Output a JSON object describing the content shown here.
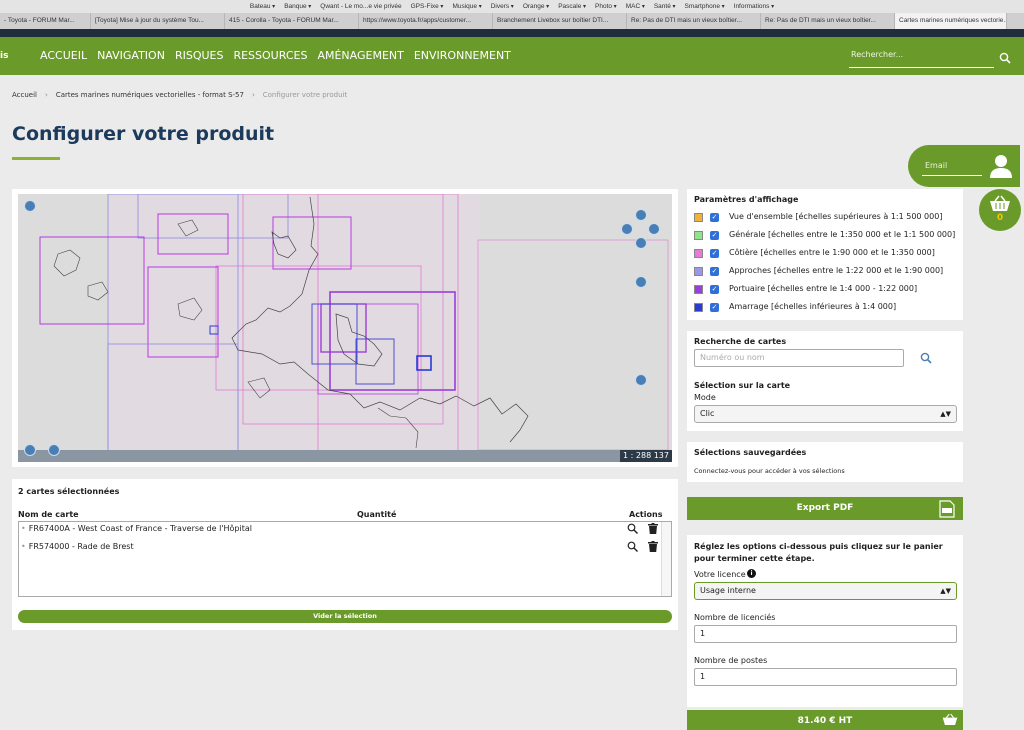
{
  "browser": {
    "bookmarks": [
      "Bateau",
      "Banque",
      "Qwant - Le mo...e vie privée",
      "GPS-Fixe",
      "Musique",
      "Divers",
      "Orange",
      "Pascale",
      "Photo",
      "MAC",
      "Santé",
      "Smartphone",
      "Informations"
    ],
    "tabs": [
      "- Toyota - FORUM Mar...",
      "[Toyota] Mise à jour du système Tou...",
      "415 - Corolla - Toyota - FORUM Mar...",
      "https://www.toyota.fr/apps/customer...",
      "Branchement Livebox sur boîtier DTI...",
      "Re: Pas de DTI mais un vieux boîtier...",
      "Re: Pas de DTI mais un vieux boîtier...",
      "Cartes marines numériques vectorie..."
    ]
  },
  "nav": {
    "brand": "is",
    "items": [
      "ACCUEIL",
      "NAVIGATION",
      "RISQUES",
      "RESSOURCES",
      "AMÉNAGEMENT",
      "ENVIRONNEMENT"
    ],
    "search_placeholder": "Rechercher..."
  },
  "breadcrumb": [
    "Accueil",
    "Cartes marines numériques vectorielles - format S-57",
    "Configurer votre produit"
  ],
  "page_title": "Configurer votre produit",
  "account": {
    "email_placeholder": "Email",
    "cart_count": "0"
  },
  "map": {
    "scale": "1 : 288 137"
  },
  "selection": {
    "count_label": "2 cartes sélectionnées",
    "col_name": "Nom de carte",
    "col_qty": "Quantité",
    "col_actions": "Actions",
    "rows": [
      {
        "name": "FR67400A - West Coast of France - Traverse de l'Hôpital"
      },
      {
        "name": "FR574000 - Rade de Brest"
      }
    ],
    "clear_label": "Vider la sélection"
  },
  "display": {
    "title": "Paramètres d'affichage",
    "layers": [
      {
        "color": "#f2b13a",
        "label": "Vue d'ensemble [échelles supérieures à 1:1 500 000]"
      },
      {
        "color": "#8fe68a",
        "label": "Générale [échelles entre le 1:350 000 et le 1:1 500 000]"
      },
      {
        "color": "#e77ad6",
        "label": "Côtière [échelles entre le 1:90 000 et le 1:350 000]"
      },
      {
        "color": "#9b95ee",
        "label": "Approches [échelles entre le 1:22 000 et le 1:90 000]"
      },
      {
        "color": "#9a3fd8",
        "label": "Portuaire [échelles entre le 1:4 000 - 1:22 000]"
      },
      {
        "color": "#2b3bd6",
        "label": "Amarrage [échelles inférieures à 1:4 000]"
      }
    ]
  },
  "search": {
    "title": "Recherche de cartes",
    "placeholder": "Numéro ou nom",
    "select_title": "Sélection sur la carte",
    "mode_label": "Mode",
    "mode_value": "Clic"
  },
  "saved": {
    "title": "Sélections sauvegardées",
    "hint": "Connectez-vous pour accéder à vos sélections"
  },
  "export_label": "Export PDF",
  "options": {
    "intro": "Réglez les options ci-dessous puis cliquez sur le panier pour terminer cette étape.",
    "licence_label": "Votre licence",
    "licence_value": "Usage interne",
    "licencies_label": "Nombre de licenciés",
    "licencies_value": "1",
    "postes_label": "Nombre de postes",
    "postes_value": "1"
  },
  "total": "81.40 € HT"
}
